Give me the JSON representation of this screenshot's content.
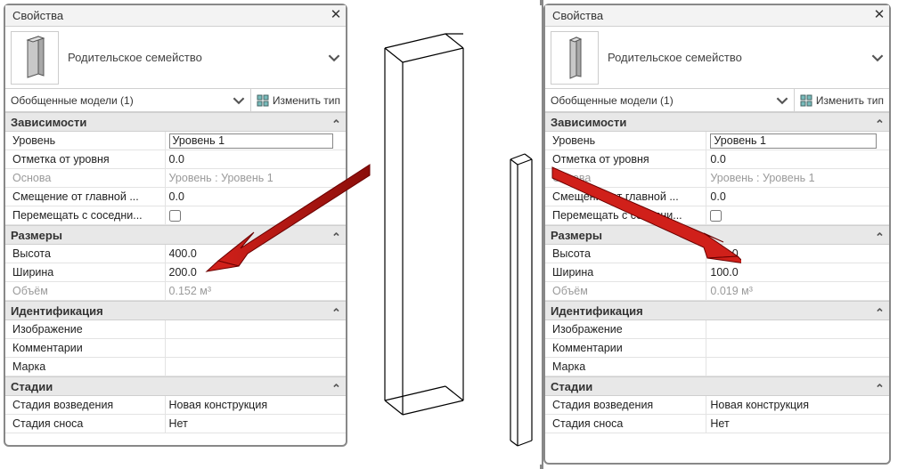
{
  "left": {
    "title": "Свойства",
    "family": "Родительское семейство",
    "instance_combo": "Обобщенные модели (1)",
    "edit_type": "Изменить тип",
    "groups": {
      "constraints": {
        "header": "Зависимости",
        "level": {
          "name": "Уровень",
          "value": "Уровень 1"
        },
        "offset": {
          "name": "Отметка от уровня",
          "value": "0.0"
        },
        "host": {
          "name": "Основа",
          "value": "Уровень : Уровень 1"
        },
        "host_off": {
          "name": "Смещение от главной ...",
          "value": "0.0"
        },
        "moves": {
          "name": "Перемещать с соседни...",
          "value": false
        }
      },
      "dims": {
        "header": "Размеры",
        "h": {
          "name": "Высота",
          "value": "400.0"
        },
        "w": {
          "name": "Ширина",
          "value": "200.0"
        },
        "vol": {
          "name": "Объём",
          "value": "0.152 м³"
        }
      },
      "ident": {
        "header": "Идентификация",
        "image": {
          "name": "Изображение",
          "value": ""
        },
        "comm": {
          "name": "Комментарии",
          "value": ""
        },
        "mark": {
          "name": "Марка",
          "value": ""
        }
      },
      "phasing": {
        "header": "Стадии",
        "created": {
          "name": "Стадия возведения",
          "value": "Новая конструкция"
        },
        "demo": {
          "name": "Стадия сноса",
          "value": "Нет"
        }
      }
    }
  },
  "right": {
    "title": "Свойства",
    "family": "Родительское семейство",
    "instance_combo": "Обобщенные модели (1)",
    "edit_type": "Изменить тип",
    "groups": {
      "constraints": {
        "header": "Зависимости",
        "level": {
          "name": "Уровень",
          "value": "Уровень 1"
        },
        "offset": {
          "name": "Отметка от уровня",
          "value": "0.0"
        },
        "host": {
          "name": "Основа",
          "value": "Уровень : Уровень 1"
        },
        "host_off": {
          "name": "Смещение от главной ...",
          "value": "0.0"
        },
        "moves": {
          "name": "Перемещать с соседни...",
          "value": false
        }
      },
      "dims": {
        "header": "Размеры",
        "h": {
          "name": "Высота",
          "value": "100.0"
        },
        "w": {
          "name": "Ширина",
          "value": "100.0"
        },
        "vol": {
          "name": "Объём",
          "value": "0.019 м³"
        }
      },
      "ident": {
        "header": "Идентификация",
        "image": {
          "name": "Изображение",
          "value": ""
        },
        "comm": {
          "name": "Комментарии",
          "value": ""
        },
        "mark": {
          "name": "Марка",
          "value": ""
        }
      },
      "phasing": {
        "header": "Стадии",
        "created": {
          "name": "Стадия возведения",
          "value": "Новая конструкция"
        },
        "demo": {
          "name": "Стадия сноса",
          "value": "Нет"
        }
      }
    }
  }
}
